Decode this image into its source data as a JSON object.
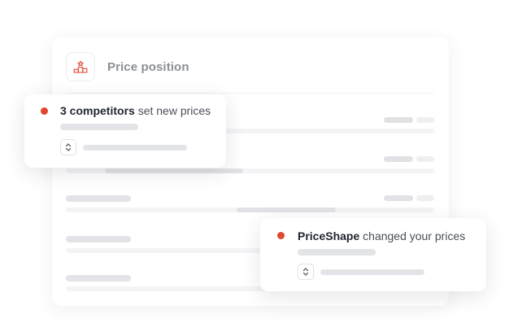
{
  "panel": {
    "title": "Price position",
    "icon": "podium-icon"
  },
  "notifications": [
    {
      "count_label": "3 competitors",
      "text": " set new prices",
      "status_color": "#e0472f",
      "control_icon": "chevron-up-down-icon"
    },
    {
      "subject": "PriceShape",
      "text": " changed your prices",
      "status_color": "#e0472f",
      "control_icon": "chevron-up-down-icon"
    }
  ],
  "colors": {
    "accent": "#e0472f",
    "title_gray": "#8c9096",
    "placeholder_bar": "#e3e4e7"
  }
}
